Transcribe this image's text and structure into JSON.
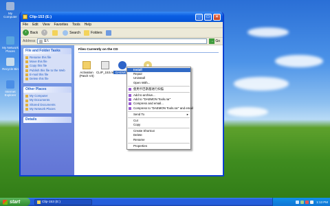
{
  "desktop": {
    "icons": [
      {
        "label": "My Computer",
        "icon": "computer-icon",
        "color": "#9fb5d9"
      },
      {
        "label": "My Network Places",
        "icon": "network-icon",
        "color": "#5aa6e0"
      },
      {
        "label": "Recycle Bin",
        "icon": "recycle-bin-icon",
        "color": "#c7dced"
      },
      {
        "label": "Internet Explorer",
        "icon": "internet-explorer-icon",
        "color": "#4a8ee6"
      }
    ]
  },
  "window": {
    "title": "Clip-153 (E:)",
    "menu": [
      "File",
      "Edit",
      "View",
      "Favorites",
      "Tools",
      "Help"
    ],
    "toolbar": {
      "back": "Back",
      "search": "Search",
      "folders": "Folders"
    },
    "address": {
      "label": "Address",
      "value": "E:\\",
      "go": "Go"
    },
    "tasks": {
      "file_folder": {
        "title": "File and Folder Tasks",
        "items": [
          "Rename this file",
          "Move this file",
          "Copy this file",
          "Publish this file to the Web",
          "E-mail this file",
          "Delete this file"
        ]
      },
      "other_places": {
        "title": "Other Places",
        "items": [
          "My Computer",
          "My Documents",
          "Shared Documents",
          "My Network Places"
        ]
      },
      "details": {
        "title": "Details"
      }
    },
    "content": {
      "section": "Files Currently on the CD",
      "files": [
        {
          "label": "Activation (Patch V3)",
          "icon": "folder-icon"
        },
        {
          "label": "CLIP_153.reg",
          "icon": "registry-file-icon"
        },
        {
          "label": "DAEMON",
          "icon": "daemon-tools-icon"
        },
        {
          "label": "",
          "icon": "cd-icon"
        }
      ]
    }
  },
  "context_menu": {
    "items": [
      {
        "label": "Install",
        "type": "item",
        "bold": true,
        "highlighted": true
      },
      {
        "label": "Repair",
        "type": "item"
      },
      {
        "label": "Uninstall",
        "type": "item"
      },
      {
        "label": "Open With...",
        "type": "item"
      },
      {
        "type": "sep"
      },
      {
        "label": "使用卡巴斯基进行扫描",
        "type": "item",
        "icon": "kaspersky-icon"
      },
      {
        "type": "sep"
      },
      {
        "label": "Add to archive...",
        "type": "item",
        "icon": "winrar-icon"
      },
      {
        "label": "Add to \"DAEMON Tools.rar\"",
        "type": "item",
        "icon": "winrar-icon"
      },
      {
        "label": "Compress and email...",
        "type": "item",
        "icon": "winrar-icon"
      },
      {
        "label": "Compress to \"DAEMON Tools.rar\" and email",
        "type": "item",
        "icon": "winrar-icon"
      },
      {
        "type": "sep"
      },
      {
        "label": "Send To",
        "type": "item",
        "submenu": true
      },
      {
        "type": "sep"
      },
      {
        "label": "Cut",
        "type": "item"
      },
      {
        "label": "Copy",
        "type": "item"
      },
      {
        "type": "sep"
      },
      {
        "label": "Create Shortcut",
        "type": "item"
      },
      {
        "label": "Delete",
        "type": "item"
      },
      {
        "label": "Rename",
        "type": "item"
      },
      {
        "type": "sep"
      },
      {
        "label": "Properties",
        "type": "item"
      }
    ]
  },
  "taskbar": {
    "start": "start",
    "task_button": "Clip-153 (E:)",
    "clock": "1:13 PM"
  }
}
